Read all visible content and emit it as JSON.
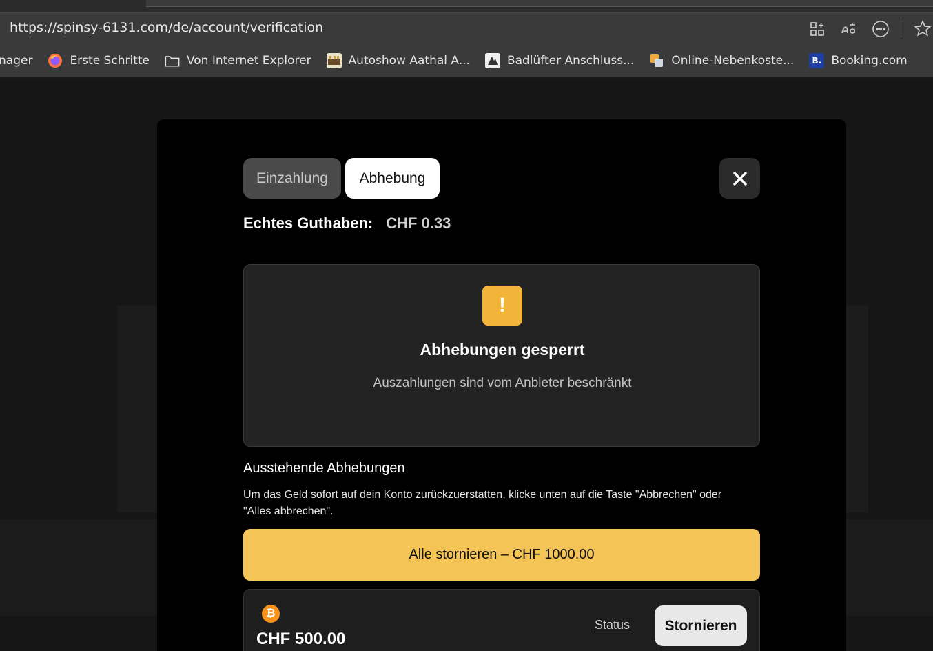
{
  "browser": {
    "url": "https://spinsy-6131.com/de/account/verification",
    "bookmarks": [
      {
        "label": "nager",
        "icon": "none"
      },
      {
        "label": "Erste Schritte",
        "icon": "firefox-icon"
      },
      {
        "label": "Von Internet Explorer",
        "icon": "folder-icon"
      },
      {
        "label": "Autoshow Aathal A...",
        "icon": "site-icon"
      },
      {
        "label": "Badlüfter Anschluss...",
        "icon": "site-icon"
      },
      {
        "label": "Online-Nebenkoste...",
        "icon": "site-icon"
      },
      {
        "label": "Booking.com",
        "icon": "booking-icon",
        "icon_text": "B."
      }
    ]
  },
  "modal": {
    "tabs": {
      "deposit": "Einzahlung",
      "withdraw": "Abhebung"
    },
    "close_symbol": "✕",
    "balance": {
      "label": "Echtes Guthaben:",
      "value": "CHF 0.33"
    },
    "notice": {
      "icon_symbol": "!",
      "title": "Abhebungen gesperrt",
      "text": "Auszahlungen sind vom Anbieter beschränkt"
    },
    "pending": {
      "title": "Ausstehende Abhebungen",
      "description": "Um das Geld sofort auf dein Konto zurückzuerstatten, klicke unten auf die Taste \"Abbrechen\" oder \"Alles abbrechen\".",
      "cancel_all_label": "Alle stornieren – CHF 1000.00",
      "items": [
        {
          "currency_icon": "bitcoin-icon",
          "currency_symbol": "₿",
          "amount": "CHF 500.00",
          "status_label": "Status",
          "cancel_label": "Stornieren"
        }
      ]
    }
  },
  "colors": {
    "accent_yellow": "#f4c457",
    "warning_yellow": "#f2b53a",
    "bitcoin_orange": "#f7931a"
  }
}
